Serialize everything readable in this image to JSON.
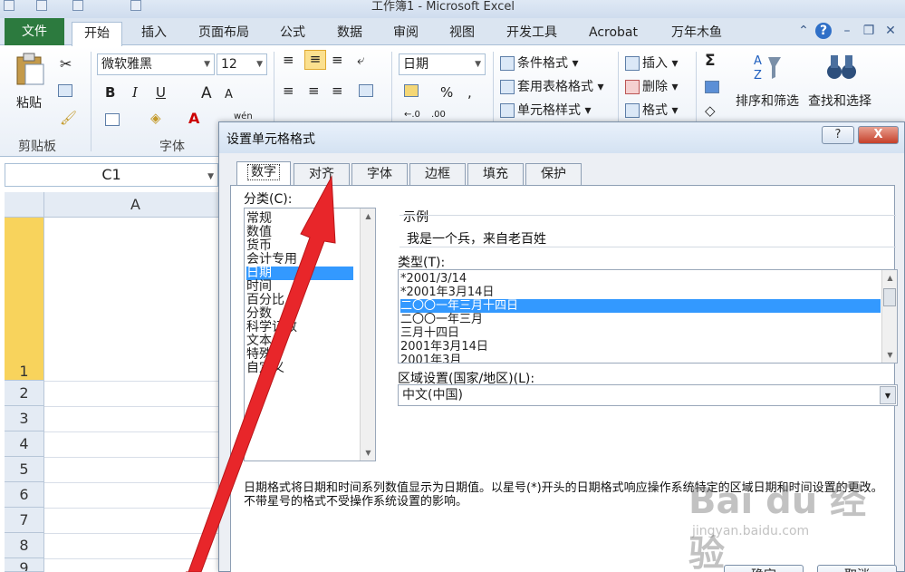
{
  "window": {
    "title": "工作簿1 - Microsoft Excel"
  },
  "ribbon_tabs": [
    "文件",
    "开始",
    "插入",
    "页面布局",
    "公式",
    "数据",
    "审阅",
    "视图",
    "开发工具",
    "Acrobat",
    "万年木鱼"
  ],
  "active_tab": "开始",
  "clipboard": {
    "paste_label": "粘贴",
    "group_label": "剪贴板"
  },
  "font": {
    "name": "微软雅黑",
    "size": "12",
    "bold": "B",
    "italic": "I",
    "underline": "U",
    "grow": "A",
    "shrink": "A",
    "color_letter": "A",
    "phonetic": "wén",
    "group_label": "字体"
  },
  "number": {
    "format": "日期"
  },
  "styles": {
    "conditional": "条件格式",
    "table": "套用表格格式",
    "cell": "单元格样式"
  },
  "cells": {
    "insert": "插入",
    "delete": "删除",
    "format": "格式"
  },
  "editing": {
    "sum": "Σ",
    "sort_filter": "排序和筛选",
    "find_select": "查找和选择"
  },
  "namebox": {
    "value": "C1"
  },
  "sheet": {
    "column_header": "A",
    "row_numbers": [
      "1",
      "2",
      "3",
      "4",
      "5",
      "6",
      "7",
      "8",
      "9"
    ]
  },
  "dialog": {
    "title": "设置单元格格式",
    "help_btn": "?",
    "close_btn": "X",
    "tabs": [
      "数字",
      "对齐",
      "字体",
      "边框",
      "填充",
      "保护"
    ],
    "active_tab": "数字",
    "category_label": "分类(C):",
    "categories": [
      "常规",
      "数值",
      "货币",
      "会计专用",
      "日期",
      "时间",
      "百分比",
      "分数",
      "科学记数",
      "文本",
      "特殊",
      "自定义"
    ],
    "selected_category": "日期",
    "sample_label": "示例",
    "sample_value": "我是一个兵，来自老百姓",
    "type_label": "类型(T):",
    "types": [
      "*2001/3/14",
      "*2001年3月14日",
      "二〇〇一年三月十四日",
      "二〇〇一年三月",
      "三月十四日",
      "2001年3月14日",
      "2001年3月"
    ],
    "selected_type": "二〇〇一年三月十四日",
    "locale_label": "区域设置(国家/地区)(L):",
    "locale_value": "中文(中国)",
    "description": "日期格式将日期和时间系列数值显示为日期值。以星号(*)开头的日期格式响应操作系统特定的区域日期和时间设置的更改。不带星号的格式不受操作系统设置的影响。",
    "ok_btn": "确定",
    "cancel_btn": "取消"
  },
  "watermark": {
    "brand": "Bai du 经验",
    "url": "jingyan.baidu.com"
  },
  "annotation": {
    "arrow_color": "#e8262a"
  },
  "colors": {
    "file_tab": "#2c7a3e",
    "selection": "#3399ff",
    "row_selected": "#f8d35c"
  }
}
